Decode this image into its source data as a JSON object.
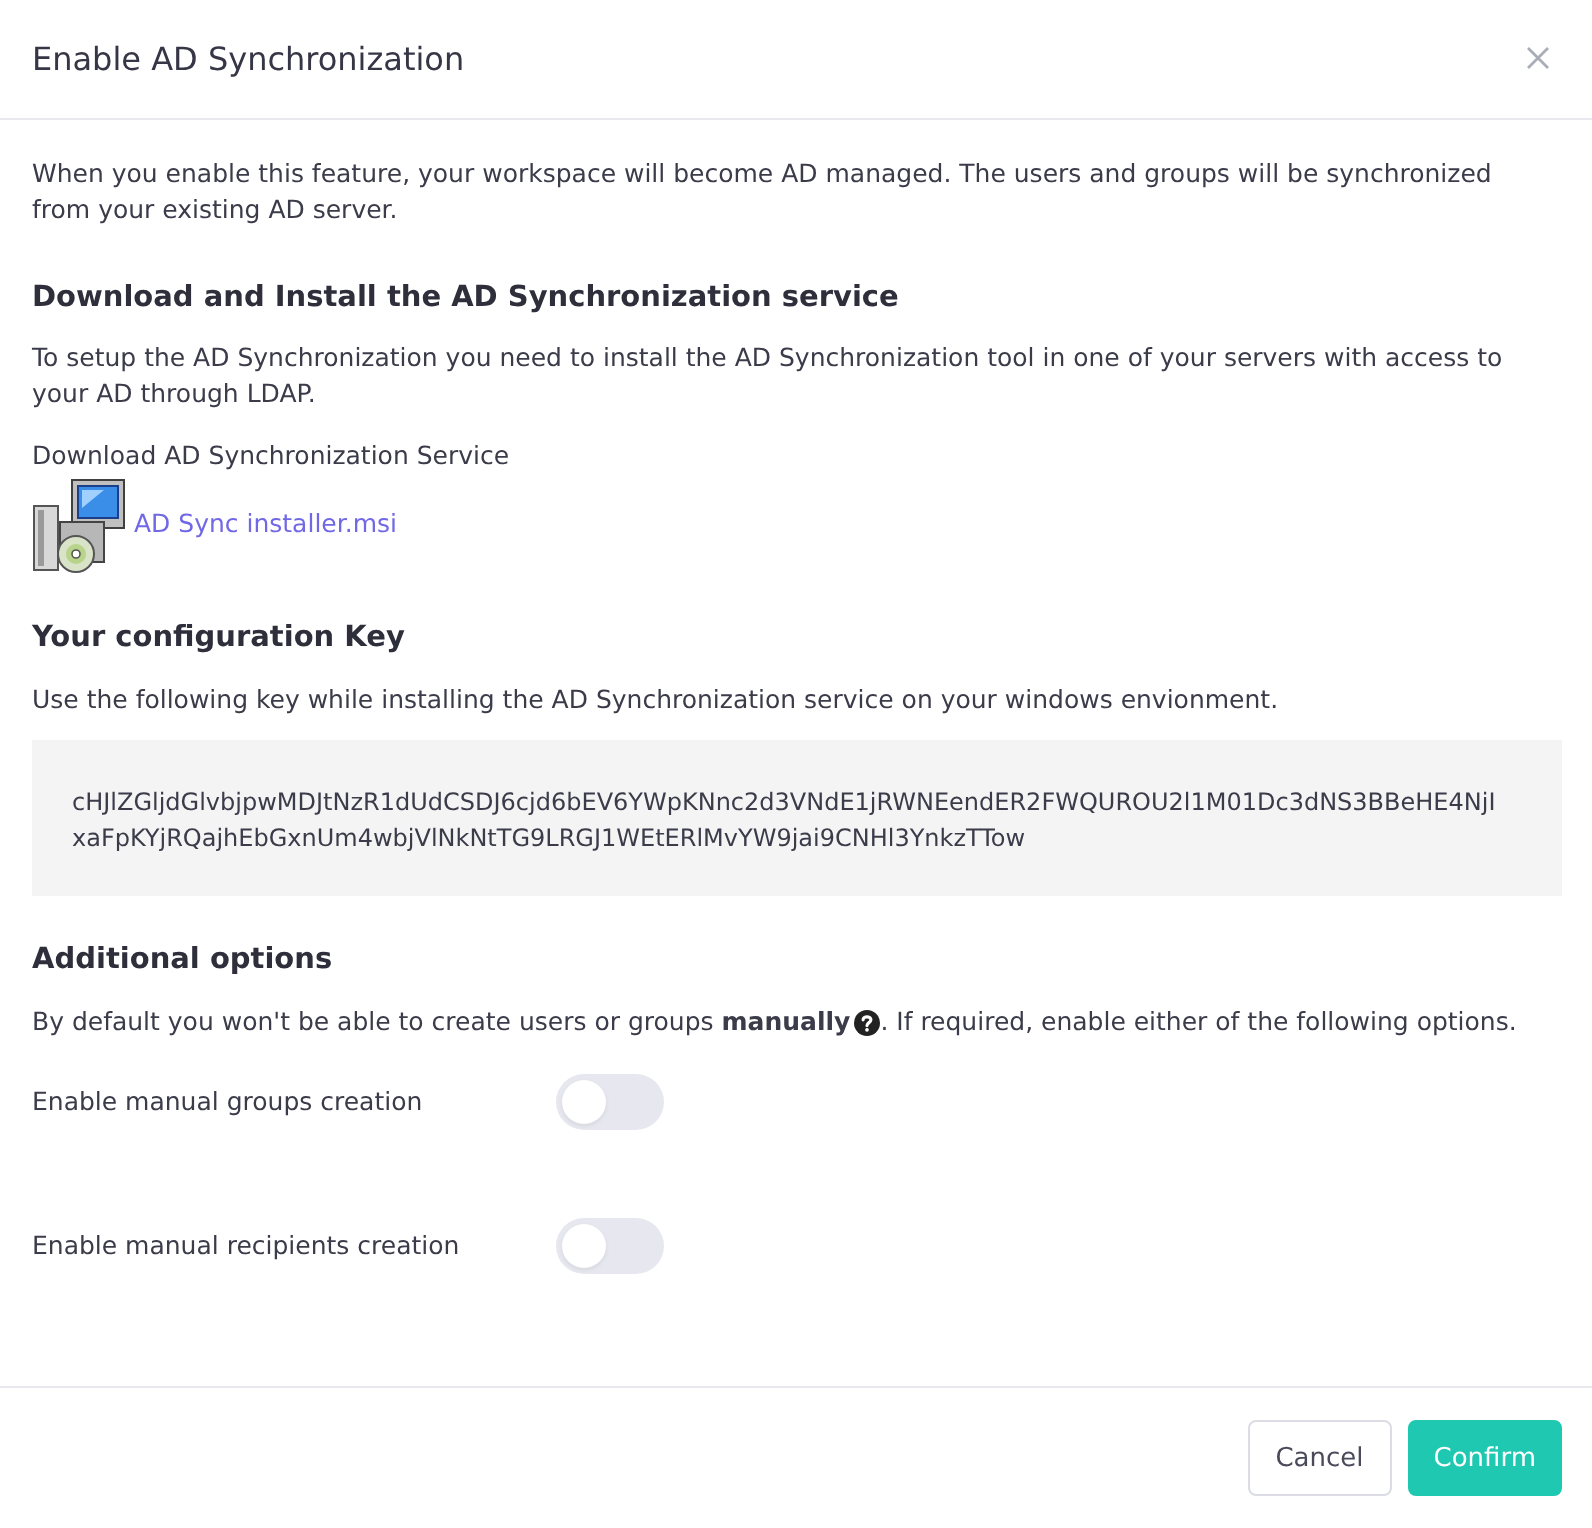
{
  "dialog": {
    "title": "Enable AD Synchronization"
  },
  "intro": "When you enable this feature, your workspace will become AD managed. The users and groups will be synchronized from your existing AD server.",
  "download_section": {
    "heading": "Download and Install the AD Synchronization service",
    "description": "To setup the AD Synchronization you need to install the AD Synchronization tool in one of your servers with access to your AD through LDAP.",
    "label": "Download AD Synchronization Service",
    "file_name": "AD Sync installer.msi"
  },
  "key_section": {
    "heading": "Your configuration Key",
    "description": "Use the following key while installing the AD Synchronization service on your windows envionment.",
    "key": "cHJlZGljdGlvbjpwMDJtNzR1dUdCSDJ6cjd6bEV6YWpKNnc2d3VNdE1jRWNEendER2FWQUROU2l1M01Dc3dNS3BBeHE4NjIxaFpKYjRQajhEbGxnUm4wbjVlNkNtTG9LRGJ1WEtERlMvYW9jai9CNHl3YnkzTTow"
  },
  "options_section": {
    "heading": "Additional options",
    "description_before": "By default you won't be able to create users or groups **manually**",
    "description_after": ". If required, enable either of the following options.",
    "options": [
      {
        "label": "Enable manual groups creation",
        "checked": false
      },
      {
        "label": "Enable manual recipients creation",
        "checked": false
      }
    ]
  },
  "buttons": [
    {
      "label": "Cancel",
      "kind": "secondary"
    },
    {
      "label": "Confirm",
      "kind": "primary"
    }
  ]
}
